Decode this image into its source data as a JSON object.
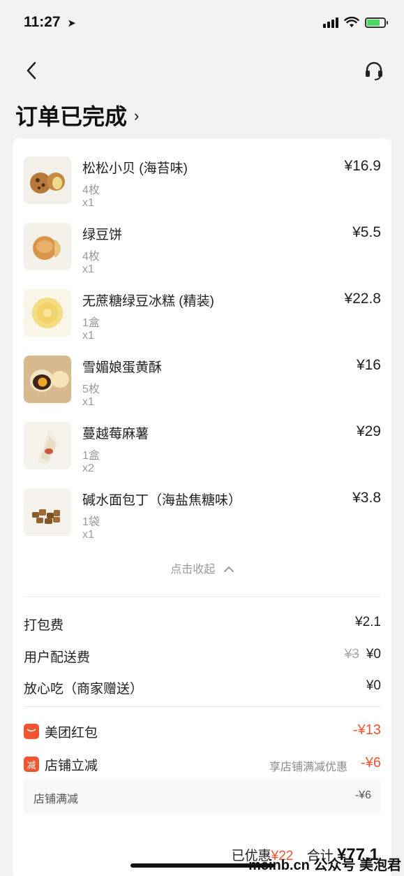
{
  "status_bar": {
    "time": "11:27"
  },
  "page": {
    "title": "订单已完成",
    "title_chevron": "›"
  },
  "items": [
    {
      "name": "松松小贝 (海苔味)",
      "spec": "4枚",
      "qty": "x1",
      "price": "¥16.9"
    },
    {
      "name": "绿豆饼",
      "spec": "4枚",
      "qty": "x1",
      "price": "¥5.5"
    },
    {
      "name": "无蔗糖绿豆冰糕 (精装)",
      "spec": "1盒",
      "qty": "x1",
      "price": "¥22.8"
    },
    {
      "name": "雪媚娘蛋黄酥",
      "spec": "5枚",
      "qty": "x1",
      "price": "¥16"
    },
    {
      "name": "蔓越莓麻薯",
      "spec": "1盒",
      "qty": "x2",
      "price": "¥29"
    },
    {
      "name": "碱水面包丁（海盐焦糖味）",
      "spec": "1袋",
      "qty": "x1",
      "price": "¥3.8"
    }
  ],
  "collapse_label": "点击收起",
  "fees": {
    "packing": {
      "label": "打包费",
      "value": "¥2.1"
    },
    "delivery": {
      "label": "用户配送费",
      "original": "¥3",
      "value": "¥0"
    },
    "safe_eat": {
      "label": "放心吃（商家赠送）",
      "value": "¥0"
    }
  },
  "discounts": {
    "red_packet": {
      "label": "美团红包",
      "value": "-¥13"
    },
    "shop_cut": {
      "icon_text": "减",
      "label": "店铺立减",
      "note": "享店铺满减优惠",
      "value": "-¥6"
    },
    "shop_full": {
      "label": "店铺满减",
      "value": "-¥6"
    }
  },
  "summary": {
    "saved_label": "已优惠",
    "saved_value": "¥22",
    "total_label": "合计",
    "total_value": "¥77.1"
  },
  "watermark": "meinb.cn 公众号 美泡君",
  "colors": {
    "accent": "#f0552f",
    "background": "#f2f2f2",
    "card": "#ffffff"
  }
}
